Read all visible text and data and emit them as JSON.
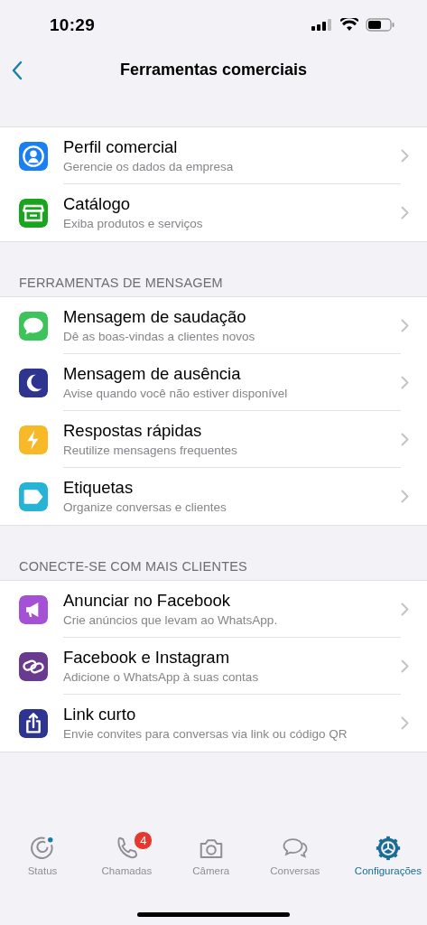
{
  "status_bar": {
    "time": "10:29"
  },
  "nav": {
    "title": "Ferramentas comerciais"
  },
  "sections": [
    {
      "items": [
        {
          "title": "Perfil comercial",
          "subtitle": "Gerencie os dados da empresa",
          "kind": "profile",
          "color": "#1a7ff0"
        },
        {
          "title": "Catálogo",
          "subtitle": "Exiba produtos e serviços",
          "kind": "store",
          "color": "#1aa51e"
        }
      ]
    },
    {
      "header": "FERRAMENTAS DE MENSAGEM",
      "items": [
        {
          "title": "Mensagem de saudação",
          "subtitle": "Dê as boas-vindas a clientes novos",
          "kind": "chat",
          "color": "#3dc35a"
        },
        {
          "title": "Mensagem de ausência",
          "subtitle": "Avise quando você não estiver disponível",
          "kind": "moon",
          "color": "#2e3590"
        },
        {
          "title": "Respostas rápidas",
          "subtitle": "Reutilize mensagens frequentes",
          "kind": "bolt",
          "color": "#f7b928"
        },
        {
          "title": "Etiquetas",
          "subtitle": "Organize conversas e clientes",
          "kind": "tag",
          "color": "#26b3d6"
        }
      ]
    },
    {
      "header": "CONECTE-SE COM MAIS CLIENTES",
      "items": [
        {
          "title": "Anunciar no Facebook",
          "subtitle": "Crie anúncios que levam ao WhatsApp.",
          "kind": "megaphone",
          "color": "#a451d6"
        },
        {
          "title": "Facebook e Instagram",
          "subtitle": "Adicione o WhatsApp à suas contas",
          "kind": "link",
          "color": "#6a3a8e"
        },
        {
          "title": "Link curto",
          "subtitle": "Envie convites para conversas via link ou código QR",
          "kind": "share",
          "color": "#2e3590"
        }
      ]
    }
  ],
  "tabs": [
    {
      "label": "Status",
      "kind": "status",
      "selected": false
    },
    {
      "label": "Chamadas",
      "kind": "calls",
      "selected": false,
      "badge": "4"
    },
    {
      "label": "Câmera",
      "kind": "camera",
      "selected": false
    },
    {
      "label": "Conversas",
      "kind": "chats",
      "selected": false
    },
    {
      "label": "Configurações",
      "kind": "settings",
      "selected": true
    }
  ]
}
